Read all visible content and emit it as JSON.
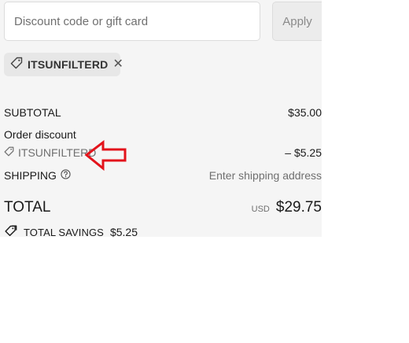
{
  "discount": {
    "placeholder": "Discount code or gift card",
    "apply_label": "Apply"
  },
  "applied_code": {
    "code": "ITSUNFILTERD",
    "remove_symbol": "✕"
  },
  "summary": {
    "subtotal_label": "SUBTOTAL",
    "subtotal_value": "$35.00",
    "order_discount_label": "Order discount",
    "discount_code": "ITSUNFILTERD",
    "discount_value": "– $5.25",
    "shipping_label": "SHIPPING",
    "shipping_value": "Enter shipping address",
    "total_label": "TOTAL",
    "total_currency": "USD",
    "total_value": "$29.75",
    "savings_label": "TOTAL SAVINGS",
    "savings_value": "$5.25"
  },
  "annotation": {
    "arrow_color": "#e3131b"
  },
  "icons": [
    "tag-icon",
    "close-icon",
    "help-icon",
    "tags-icon",
    "red-arrow-annotation"
  ]
}
